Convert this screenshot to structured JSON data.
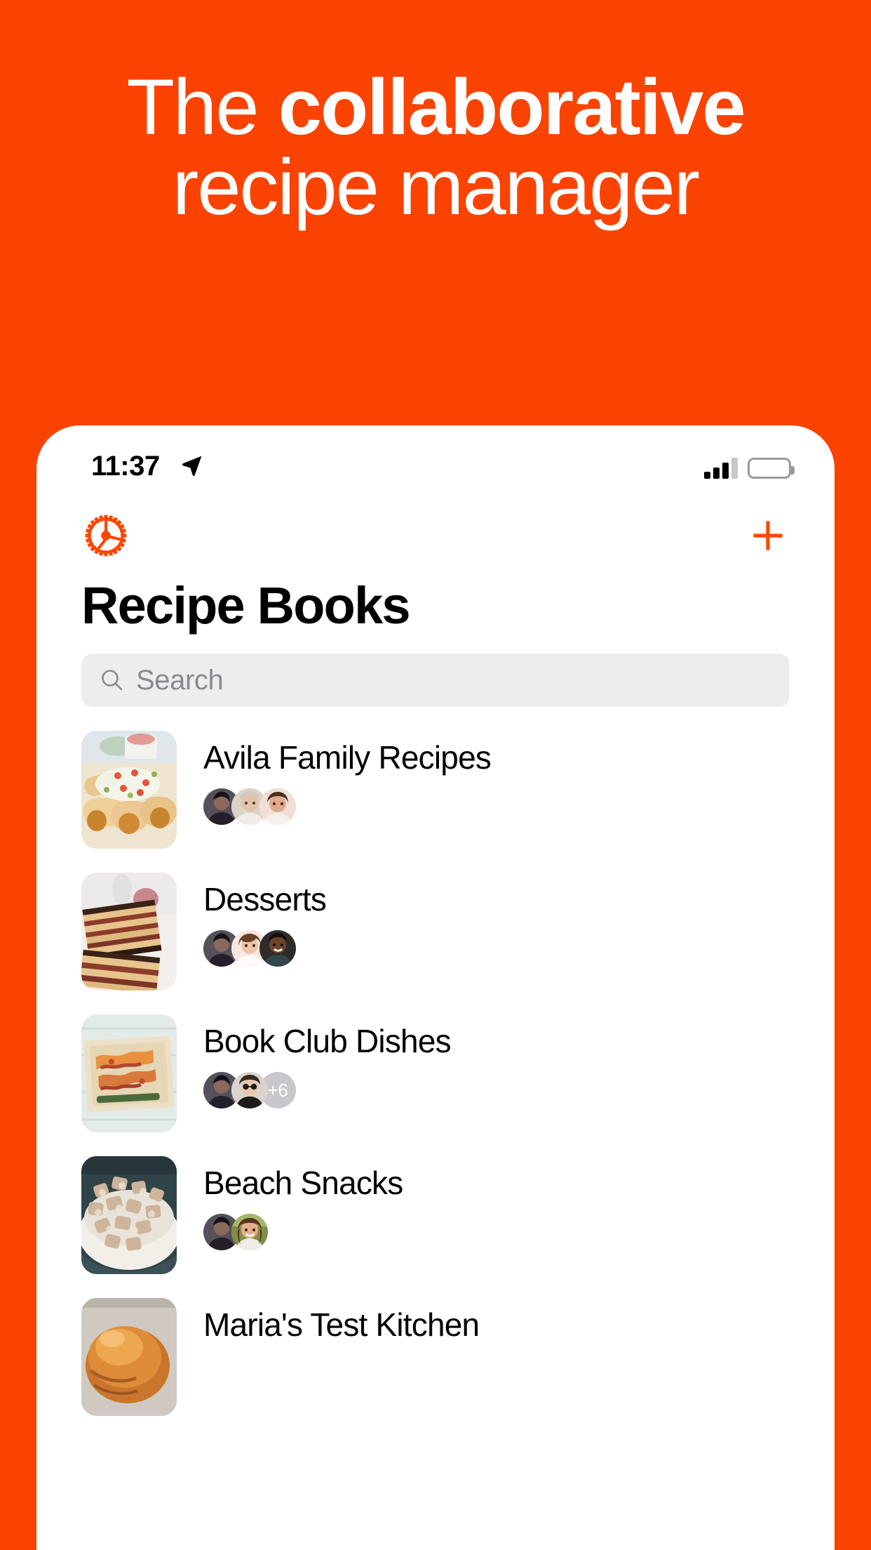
{
  "theme": {
    "brand_orange": "#FA4300",
    "accent": "#FF4500",
    "search_bg": "#EDEDED",
    "placeholder_color": "#8A8A8E",
    "badge_bg": "#C7C7CC"
  },
  "headline": {
    "line1_light": "The ",
    "line1_bold": "collaborative",
    "line2": "recipe manager"
  },
  "status_bar": {
    "time": "11:37",
    "location_icon": "location-arrow-icon",
    "signal_icon": "cellular-bars-icon",
    "battery_icon": "battery-full-icon"
  },
  "nav": {
    "settings_icon": "gear-icon",
    "add_icon": "plus-icon"
  },
  "screen": {
    "title": "Recipe Books"
  },
  "search": {
    "icon": "search-icon",
    "placeholder": "Search",
    "value": ""
  },
  "books": [
    {
      "title": "Avila Family Recipes",
      "thumb": "taquitos-photo",
      "avatars": 3,
      "more_count": "",
      "avatar_colors": [
        "#4b4a52",
        "#d8cfc6",
        "#f0ddd6"
      ]
    },
    {
      "title": "Desserts",
      "thumb": "layer-cake-photo",
      "avatars": 3,
      "more_count": "",
      "avatar_colors": [
        "#4b4a52",
        "#f3ded3",
        "#2d2a28"
      ]
    },
    {
      "title": "Book Club Dishes",
      "thumb": "bacon-flatbread-photo",
      "avatars": 2,
      "more_count": "+6",
      "avatar_colors": [
        "#4b4a52",
        "#cfcac3"
      ]
    },
    {
      "title": "Beach Snacks",
      "thumb": "puppy-chow-photo",
      "avatars": 2,
      "more_count": "",
      "avatar_colors": [
        "#4b4a52",
        "#7f8f4a"
      ]
    },
    {
      "title": "Maria's Test Kitchen",
      "thumb": "challah-bread-photo",
      "avatars": 0,
      "more_count": "",
      "avatar_colors": []
    }
  ]
}
